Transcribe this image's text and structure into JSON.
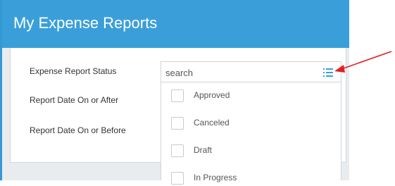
{
  "header": {
    "title": "My Expense Reports"
  },
  "form": {
    "status_label": "Expense Report Status",
    "date_after_label": "Report Date On or After",
    "date_before_label": "Report Date On or Before"
  },
  "search": {
    "placeholder": "search",
    "value": ""
  },
  "dropdown": {
    "options": [
      {
        "label": "Approved",
        "checked": false
      },
      {
        "label": "Canceled",
        "checked": false
      },
      {
        "label": "Draft",
        "checked": false
      },
      {
        "label": "In Progress",
        "checked": false
      }
    ]
  },
  "colors": {
    "header_blue": "#3a9fd9",
    "annotation_arrow": "#e02020",
    "icon_blue": "#3a9fd9"
  },
  "icons": {
    "list": "list-icon"
  }
}
